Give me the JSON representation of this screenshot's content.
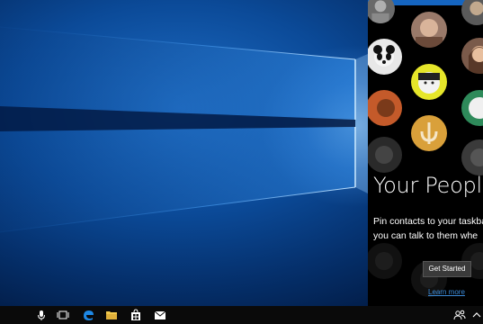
{
  "people_panel": {
    "title": "Your People",
    "description_lines": [
      "Pin contacts to your taskbar so",
      "you can talk to them whe"
    ],
    "get_started_label": "Get Started",
    "learn_more_label": "Learn more",
    "accent_color": "#1565c0"
  },
  "taskbar": {
    "icons": [
      "microphone-icon",
      "task-view-icon",
      "edge-icon",
      "file-explorer-icon",
      "store-icon",
      "mail-icon",
      "people-icon",
      "chevron-up-icon"
    ]
  }
}
